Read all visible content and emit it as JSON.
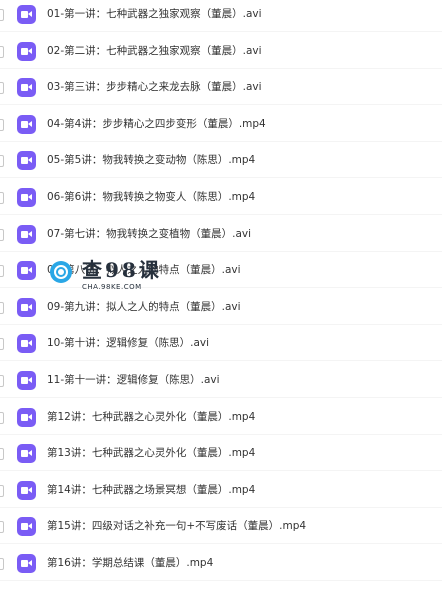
{
  "files": [
    {
      "name": "01-第一讲：七种武器之独家观察（董晨）.avi",
      "icon": "video-file-icon"
    },
    {
      "name": "02-第二讲：七种武器之独家观察（董晨）.avi",
      "icon": "video-file-icon"
    },
    {
      "name": "03-第三讲：步步精心之来龙去脉（董晨）.avi",
      "icon": "video-file-icon"
    },
    {
      "name": "04-第4讲：步步精心之四步变形（董晨）.mp4",
      "icon": "video-file-icon"
    },
    {
      "name": "05-第5讲：物我转换之变动物（陈思）.mp4",
      "icon": "video-file-icon"
    },
    {
      "name": "06-第6讲：物我转换之物变人（陈思）.mp4",
      "icon": "video-file-icon"
    },
    {
      "name": "07-第七讲：物我转换之变植物（董晨）.avi",
      "icon": "video-file-icon"
    },
    {
      "name": "08-第八讲：拟人之人的特点（董晨）.avi",
      "icon": "video-file-icon"
    },
    {
      "name": "09-第九讲：拟人之人的特点（董晨）.avi",
      "icon": "video-file-icon"
    },
    {
      "name": "10-第十讲：逻辑修复（陈思）.avi",
      "icon": "video-file-icon"
    },
    {
      "name": "11-第十一讲：逻辑修复（陈思）.avi",
      "icon": "video-file-icon"
    },
    {
      "name": "第12讲：七种武器之心灵外化（董晨）.mp4",
      "icon": "video-file-icon"
    },
    {
      "name": "第13讲：七种武器之心灵外化（董晨）.mp4",
      "icon": "video-file-icon"
    },
    {
      "name": "第14讲：七种武器之场景冥想（董晨）.mp4",
      "icon": "video-file-icon"
    },
    {
      "name": "第15讲：四级对话之补充一句+不写废话（董晨）.mp4",
      "icon": "video-file-icon"
    },
    {
      "name": "第16讲：学期总结课（董晨）.mp4",
      "icon": "video-file-icon"
    }
  ],
  "watermark": {
    "title": "查98课",
    "subtitle": "CHA.98KE.COM"
  },
  "colors": {
    "video_icon": "#7a5cf5",
    "watermark_icon": "#2aa7e6",
    "text": "#333333"
  }
}
